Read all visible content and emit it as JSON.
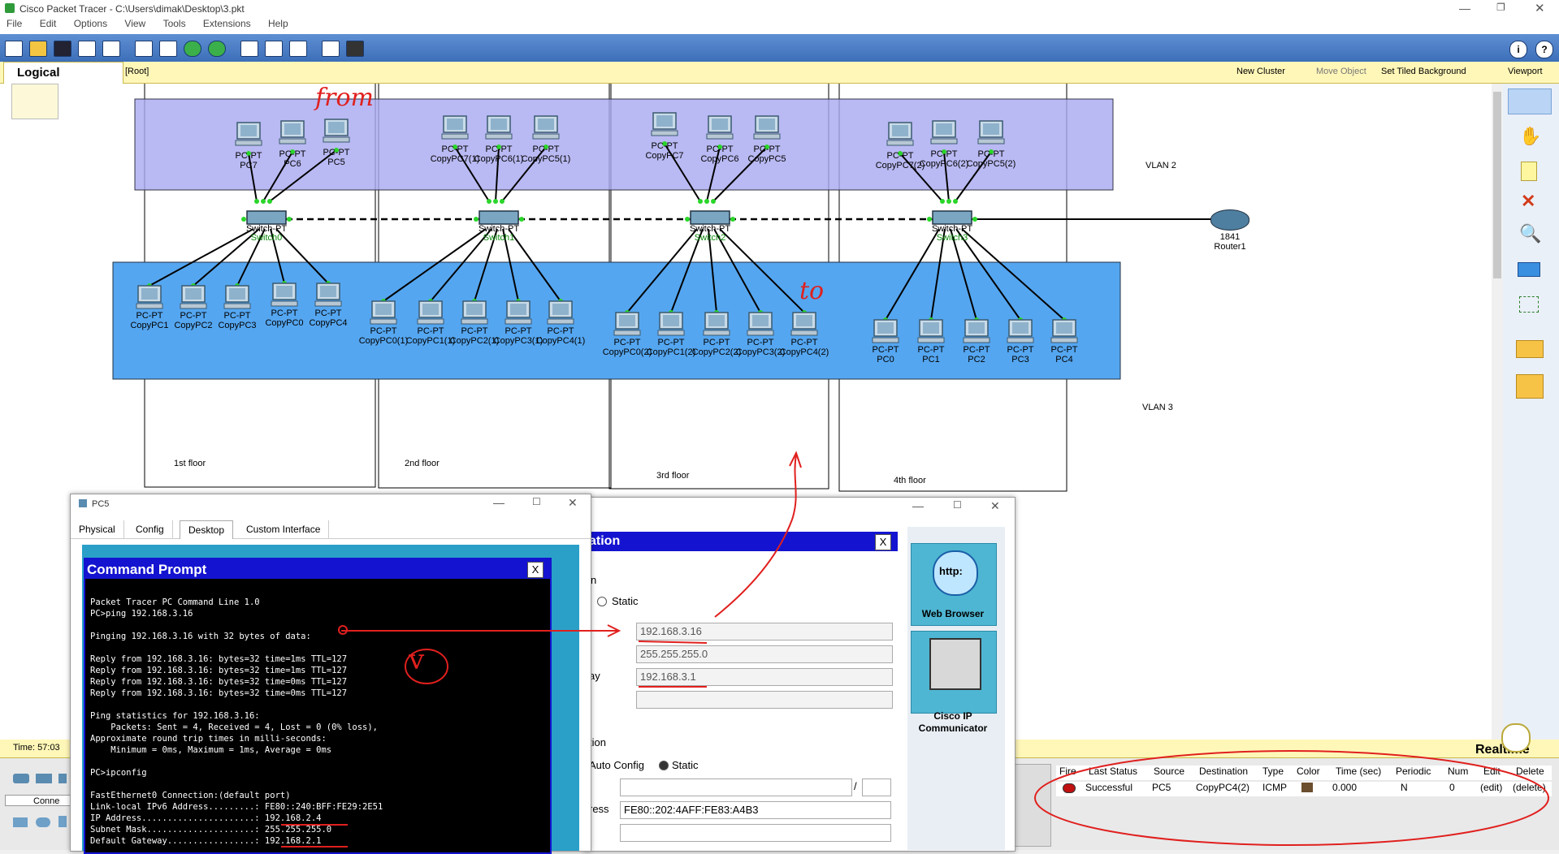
{
  "window": {
    "title": "Cisco Packet Tracer - C:\\Users\\dimak\\Desktop\\3.pkt"
  },
  "menu": [
    "File",
    "Edit",
    "Options",
    "View",
    "Tools",
    "Extensions",
    "Help"
  ],
  "logicalbar": {
    "logical": "Logical",
    "root": "[Root]",
    "new_cluster": "New Cluster",
    "move_object": "Move Object",
    "set_tiled": "Set Tiled Background",
    "viewport": "Viewport"
  },
  "network": {
    "vlan2": "VLAN 2",
    "vlan3": "VLAN 3",
    "floors": [
      "1st floor",
      "2nd floor",
      "3rd floor",
      "4th floor"
    ],
    "router": {
      "model": "1841",
      "name": "Router1"
    },
    "switch_model": "Switch-PT",
    "switches": [
      "Switch0",
      "Switch1",
      "Switch2",
      "Switch3"
    ],
    "pc_type": "PC-PT",
    "top_pcs": [
      [
        "PC7",
        "PC6",
        "PC5"
      ],
      [
        "CopyPC7(1)",
        "CopyPC6(1)",
        "CopyPC5(1)"
      ],
      [
        "CopyPC7",
        "CopyPC6",
        "CopyPC5"
      ],
      [
        "CopyPC7(2)",
        "CopyPC6(2)",
        "CopyPC5(2)"
      ]
    ],
    "bottom_pcs": [
      [
        "CopyPC1",
        "CopyPC2",
        "CopyPC3",
        "CopyPC0",
        "CopyPC4"
      ],
      [
        "CopyPC0(1)",
        "CopyPC1(1)",
        "CopyPC2(1)",
        "CopyPC3(1)",
        "CopyPC4(1)"
      ],
      [
        "CopyPC0(2)",
        "CopyPC1(2)",
        "CopyPC2(2)",
        "CopyPC3(2)",
        "CopyPC4(2)"
      ],
      [
        "PC0",
        "PC1",
        "PC2",
        "PC3",
        "PC4"
      ]
    ],
    "annotations": {
      "from": "from",
      "to": "to",
      "check": "v"
    }
  },
  "pc_window": {
    "title": "PC5",
    "tabs": [
      "Physical",
      "Config",
      "Desktop",
      "Custom Interface"
    ],
    "active_tab": "Desktop"
  },
  "cmd": {
    "title": "Command Prompt",
    "lines": [
      "Packet Tracer PC Command Line 1.0",
      "PC>ping 192.168.3.16",
      "",
      "Pinging 192.168.3.16 with 32 bytes of data:",
      "",
      "Reply from 192.168.3.16: bytes=32 time=1ms TTL=127",
      "Reply from 192.168.3.16: bytes=32 time=1ms TTL=127",
      "Reply from 192.168.3.16: bytes=32 time=0ms TTL=127",
      "Reply from 192.168.3.16: bytes=32 time=0ms TTL=127",
      "",
      "Ping statistics for 192.168.3.16:",
      "    Packets: Sent = 4, Received = 4, Lost = 0 (0% loss),",
      "Approximate round trip times in milli-seconds:",
      "    Minimum = 0ms, Maximum = 1ms, Average = 0ms",
      "",
      "PC>ipconfig",
      "",
      "FastEthernet0 Connection:(default port)",
      "Link-local IPv6 Address.........: FE80::240:BFF:FE29:2E51",
      "IP Address......................: 192.168.2.4",
      "Subnet Mask.....................: 255.255.255.0",
      "Default Gateway.................: 192.168.2.1"
    ]
  },
  "ipconfig_window": {
    "title_fragment": "ation",
    "close": "X",
    "section1": "n",
    "static_label": "Static",
    "ip": "192.168.3.16",
    "mask": "255.255.255.0",
    "gateway_label": "ay",
    "gateway": "192.168.3.1",
    "section2": "tion",
    "auto_config": "Auto Config",
    "static2": "Static",
    "slash": "/",
    "ress_label": "ress",
    "link_local": "FE80::202:4AFF:FE83:A4B3"
  },
  "desktop_apps": [
    {
      "label": "Web Browser",
      "icon_text": "http:"
    },
    {
      "label": "Cisco IP Communicator"
    }
  ],
  "status": {
    "time": "Time: 57:03",
    "connections_label": "Conne",
    "realtime": "Realtime"
  },
  "pdu_table": {
    "headers": [
      "Fire",
      "Last Status",
      "Source",
      "Destination",
      "Type",
      "Color",
      "Time (sec)",
      "Periodic",
      "Num",
      "Edit",
      "Delete"
    ],
    "rows": [
      {
        "last_status": "Successful",
        "source": "PC5",
        "destination": "CopyPC4(2)",
        "type": "ICMP",
        "color": "#6b4e2e",
        "time": "0.000",
        "periodic": "N",
        "num": "0",
        "edit": "(edit)",
        "delete": "(delete)"
      }
    ]
  },
  "colors": {
    "vlan2": "#a8a8f0",
    "vlan3": "#55a6f0",
    "toolbar": "#4a7cc4",
    "annotation": "#e0201e"
  }
}
